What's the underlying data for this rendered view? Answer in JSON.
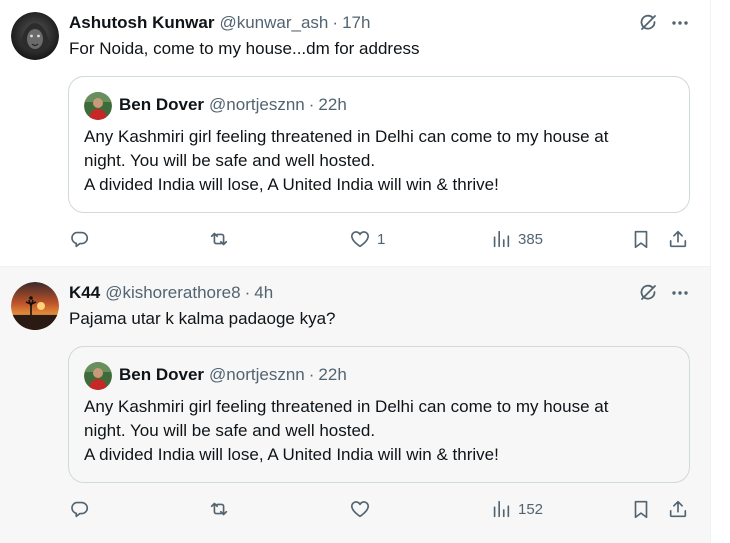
{
  "tweets": [
    {
      "name": "Ashutosh Kunwar",
      "handle": "@kunwar_ash",
      "separator": "·",
      "time": "17h",
      "text": "For Noida, come to my house...dm for address",
      "quote": {
        "name": "Ben Dover",
        "handle": "@nortjesznn",
        "separator": "·",
        "time": "22h",
        "lines": [
          "Any Kashmiri girl feeling threatened in Delhi can come to my house at",
          "night. You will be safe and well hosted.",
          "A divided India will lose, A United India will win & thrive!"
        ]
      },
      "actions": {
        "replies": "",
        "reposts": "",
        "likes": "1",
        "views": "385"
      }
    },
    {
      "name": "K44",
      "handle": "@kishorerathore8",
      "separator": "·",
      "time": "4h",
      "text": "Pajama utar k kalma padaoge kya?",
      "quote": {
        "name": "Ben Dover",
        "handle": "@nortjesznn",
        "separator": "·",
        "time": "22h",
        "lines": [
          "Any Kashmiri girl feeling threatened in Delhi can come to my house at",
          "night. You will be safe and well hosted.",
          "A divided India will lose, A United India will win & thrive!"
        ]
      },
      "actions": {
        "replies": "",
        "reposts": "",
        "likes": "",
        "views": "152"
      }
    }
  ],
  "icons": {
    "avatar1": "lion-avatar-icon",
    "avatar2": "sunset-avatar-icon",
    "quote_avatar": "quoted-user-avatar-icon",
    "grok": "grok-icon",
    "more": "more-options-icon",
    "reply": "reply-icon",
    "repost": "repost-icon",
    "like": "heart-icon",
    "views": "views-chart-icon",
    "bookmark": "bookmark-icon",
    "share": "share-icon"
  },
  "colors": {
    "text_primary": "#0f1419",
    "text_secondary": "#536471",
    "border": "#cfd9de",
    "highlight_bg": "#f7f7f7"
  }
}
